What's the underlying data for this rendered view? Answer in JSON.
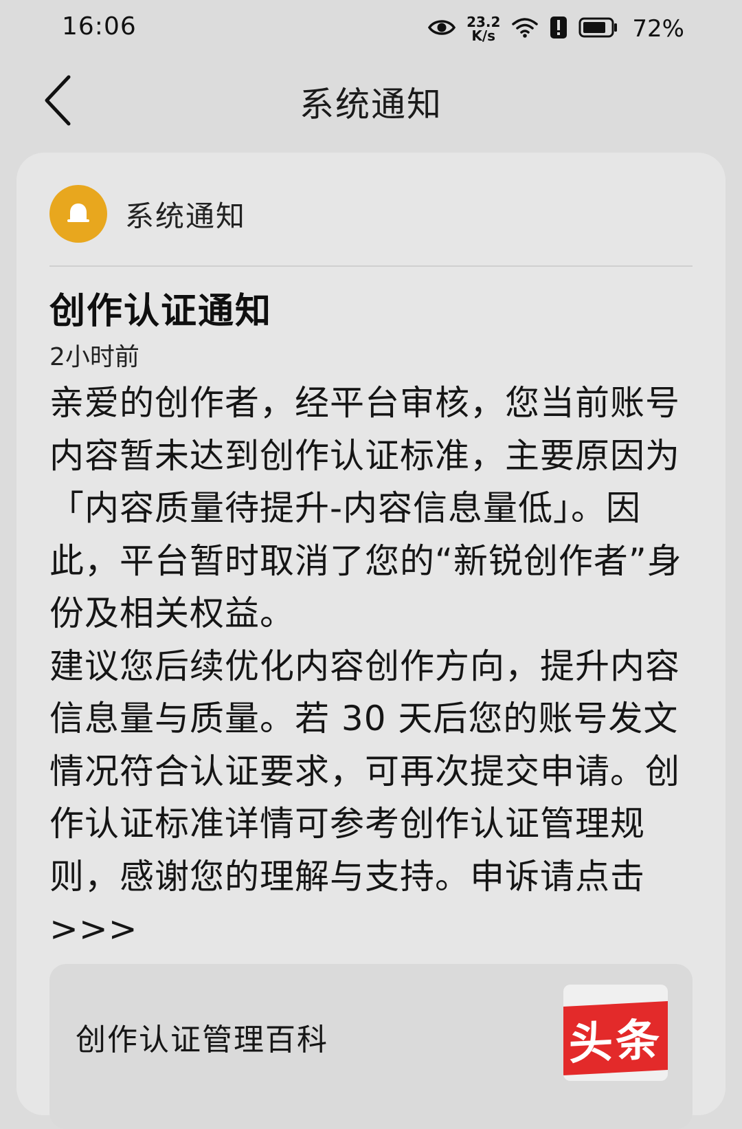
{
  "status_bar": {
    "time": "16:06",
    "net_speed_value": "23.2",
    "net_speed_unit": "K/s",
    "battery": "72%"
  },
  "header": {
    "title": "系统通知"
  },
  "notice": {
    "sender": "系统通知",
    "title": "创作认证通知",
    "time": "2小时前",
    "paragraph1": "亲爱的创作者，经平台审核，您当前账号内容暂未达到创作认证标准，主要原因为「内容质量待提升-内容信息量低」。因此，平台暂时取消了您的“新锐创作者”身份及相关权益。",
    "paragraph2": "建议您后续优化内容创作方向，提升内容信息量与质量。若 30 天后您的账号发文情况符合认证要求，可再次提交申请。创作认证标准详情可参考创作认证管理规则，感谢您的理解与支持。申诉请点击>>>"
  },
  "link_card": {
    "title": "创作认证管理百科",
    "logo_text": "头条"
  },
  "colors": {
    "background": "#dcdcdc",
    "card": "#e6e6e6",
    "avatar": "#e8a71e",
    "logo_red": "#e32a2a"
  },
  "icons": {
    "status": [
      "eye-icon",
      "wifi-icon",
      "alert-icon",
      "battery-icon"
    ],
    "header": "back-arrow-icon",
    "avatar": "bell-icon"
  }
}
